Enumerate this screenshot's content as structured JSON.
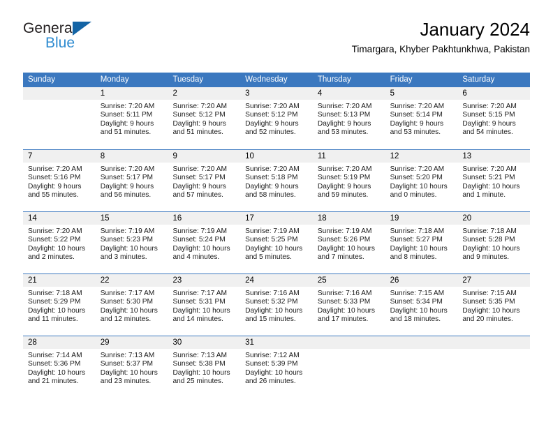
{
  "brand": {
    "name_part1": "General",
    "name_part2": "Blue",
    "accent_color": "#1464a5",
    "secondary_color": "#2e8bd0"
  },
  "header": {
    "title": "January 2024",
    "subtitle": "Timargara, Khyber Pakhtunkhwa, Pakistan"
  },
  "calendar": {
    "header_bg": "#3b78bf",
    "daynum_bg": "#f0f0f0",
    "weekdays": [
      "Sunday",
      "Monday",
      "Tuesday",
      "Wednesday",
      "Thursday",
      "Friday",
      "Saturday"
    ],
    "weeks": [
      [
        {
          "day": "",
          "lines": []
        },
        {
          "day": "1",
          "lines": [
            "Sunrise: 7:20 AM",
            "Sunset: 5:11 PM",
            "Daylight: 9 hours",
            "and 51 minutes."
          ]
        },
        {
          "day": "2",
          "lines": [
            "Sunrise: 7:20 AM",
            "Sunset: 5:12 PM",
            "Daylight: 9 hours",
            "and 51 minutes."
          ]
        },
        {
          "day": "3",
          "lines": [
            "Sunrise: 7:20 AM",
            "Sunset: 5:12 PM",
            "Daylight: 9 hours",
            "and 52 minutes."
          ]
        },
        {
          "day": "4",
          "lines": [
            "Sunrise: 7:20 AM",
            "Sunset: 5:13 PM",
            "Daylight: 9 hours",
            "and 53 minutes."
          ]
        },
        {
          "day": "5",
          "lines": [
            "Sunrise: 7:20 AM",
            "Sunset: 5:14 PM",
            "Daylight: 9 hours",
            "and 53 minutes."
          ]
        },
        {
          "day": "6",
          "lines": [
            "Sunrise: 7:20 AM",
            "Sunset: 5:15 PM",
            "Daylight: 9 hours",
            "and 54 minutes."
          ]
        }
      ],
      [
        {
          "day": "7",
          "lines": [
            "Sunrise: 7:20 AM",
            "Sunset: 5:16 PM",
            "Daylight: 9 hours",
            "and 55 minutes."
          ]
        },
        {
          "day": "8",
          "lines": [
            "Sunrise: 7:20 AM",
            "Sunset: 5:17 PM",
            "Daylight: 9 hours",
            "and 56 minutes."
          ]
        },
        {
          "day": "9",
          "lines": [
            "Sunrise: 7:20 AM",
            "Sunset: 5:17 PM",
            "Daylight: 9 hours",
            "and 57 minutes."
          ]
        },
        {
          "day": "10",
          "lines": [
            "Sunrise: 7:20 AM",
            "Sunset: 5:18 PM",
            "Daylight: 9 hours",
            "and 58 minutes."
          ]
        },
        {
          "day": "11",
          "lines": [
            "Sunrise: 7:20 AM",
            "Sunset: 5:19 PM",
            "Daylight: 9 hours",
            "and 59 minutes."
          ]
        },
        {
          "day": "12",
          "lines": [
            "Sunrise: 7:20 AM",
            "Sunset: 5:20 PM",
            "Daylight: 10 hours",
            "and 0 minutes."
          ]
        },
        {
          "day": "13",
          "lines": [
            "Sunrise: 7:20 AM",
            "Sunset: 5:21 PM",
            "Daylight: 10 hours",
            "and 1 minute."
          ]
        }
      ],
      [
        {
          "day": "14",
          "lines": [
            "Sunrise: 7:20 AM",
            "Sunset: 5:22 PM",
            "Daylight: 10 hours",
            "and 2 minutes."
          ]
        },
        {
          "day": "15",
          "lines": [
            "Sunrise: 7:19 AM",
            "Sunset: 5:23 PM",
            "Daylight: 10 hours",
            "and 3 minutes."
          ]
        },
        {
          "day": "16",
          "lines": [
            "Sunrise: 7:19 AM",
            "Sunset: 5:24 PM",
            "Daylight: 10 hours",
            "and 4 minutes."
          ]
        },
        {
          "day": "17",
          "lines": [
            "Sunrise: 7:19 AM",
            "Sunset: 5:25 PM",
            "Daylight: 10 hours",
            "and 5 minutes."
          ]
        },
        {
          "day": "18",
          "lines": [
            "Sunrise: 7:19 AM",
            "Sunset: 5:26 PM",
            "Daylight: 10 hours",
            "and 7 minutes."
          ]
        },
        {
          "day": "19",
          "lines": [
            "Sunrise: 7:18 AM",
            "Sunset: 5:27 PM",
            "Daylight: 10 hours",
            "and 8 minutes."
          ]
        },
        {
          "day": "20",
          "lines": [
            "Sunrise: 7:18 AM",
            "Sunset: 5:28 PM",
            "Daylight: 10 hours",
            "and 9 minutes."
          ]
        }
      ],
      [
        {
          "day": "21",
          "lines": [
            "Sunrise: 7:18 AM",
            "Sunset: 5:29 PM",
            "Daylight: 10 hours",
            "and 11 minutes."
          ]
        },
        {
          "day": "22",
          "lines": [
            "Sunrise: 7:17 AM",
            "Sunset: 5:30 PM",
            "Daylight: 10 hours",
            "and 12 minutes."
          ]
        },
        {
          "day": "23",
          "lines": [
            "Sunrise: 7:17 AM",
            "Sunset: 5:31 PM",
            "Daylight: 10 hours",
            "and 14 minutes."
          ]
        },
        {
          "day": "24",
          "lines": [
            "Sunrise: 7:16 AM",
            "Sunset: 5:32 PM",
            "Daylight: 10 hours",
            "and 15 minutes."
          ]
        },
        {
          "day": "25",
          "lines": [
            "Sunrise: 7:16 AM",
            "Sunset: 5:33 PM",
            "Daylight: 10 hours",
            "and 17 minutes."
          ]
        },
        {
          "day": "26",
          "lines": [
            "Sunrise: 7:15 AM",
            "Sunset: 5:34 PM",
            "Daylight: 10 hours",
            "and 18 minutes."
          ]
        },
        {
          "day": "27",
          "lines": [
            "Sunrise: 7:15 AM",
            "Sunset: 5:35 PM",
            "Daylight: 10 hours",
            "and 20 minutes."
          ]
        }
      ],
      [
        {
          "day": "28",
          "lines": [
            "Sunrise: 7:14 AM",
            "Sunset: 5:36 PM",
            "Daylight: 10 hours",
            "and 21 minutes."
          ]
        },
        {
          "day": "29",
          "lines": [
            "Sunrise: 7:13 AM",
            "Sunset: 5:37 PM",
            "Daylight: 10 hours",
            "and 23 minutes."
          ]
        },
        {
          "day": "30",
          "lines": [
            "Sunrise: 7:13 AM",
            "Sunset: 5:38 PM",
            "Daylight: 10 hours",
            "and 25 minutes."
          ]
        },
        {
          "day": "31",
          "lines": [
            "Sunrise: 7:12 AM",
            "Sunset: 5:39 PM",
            "Daylight: 10 hours",
            "and 26 minutes."
          ]
        },
        {
          "day": "",
          "lines": []
        },
        {
          "day": "",
          "lines": []
        },
        {
          "day": "",
          "lines": []
        }
      ]
    ]
  }
}
